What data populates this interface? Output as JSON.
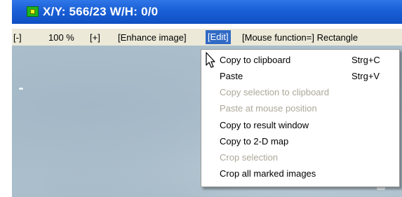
{
  "titlebar": {
    "title": "X/Y: 566/23 W/H: 0/0",
    "icon": "app-icon"
  },
  "menubar": {
    "items": [
      {
        "label": "[-]"
      },
      {
        "label": "100 %"
      },
      {
        "label": "[+]"
      },
      {
        "label": "[Enhance image]"
      },
      {
        "label": "[Edit]",
        "active": true
      },
      {
        "label": "[Mouse function=] Rectangle"
      }
    ]
  },
  "edit_menu": {
    "items": [
      {
        "label": "Copy to clipboard",
        "shortcut": "Strg+C",
        "enabled": true
      },
      {
        "label": "Paste",
        "shortcut": "Strg+V",
        "enabled": true
      },
      {
        "label": "Copy selection to clipboard",
        "enabled": false
      },
      {
        "label": "Paste at mouse position",
        "enabled": false
      },
      {
        "label": "Copy to result window",
        "enabled": true
      },
      {
        "label": "Copy to 2-D map",
        "enabled": true
      },
      {
        "label": "Crop selection",
        "enabled": false
      },
      {
        "label": "Crop all marked images",
        "enabled": true
      }
    ]
  },
  "colors": {
    "titlebar": "#1a5fd6",
    "menubar": "#ece9d8",
    "highlight": "#316ac5",
    "disabled_text": "#aca899"
  }
}
